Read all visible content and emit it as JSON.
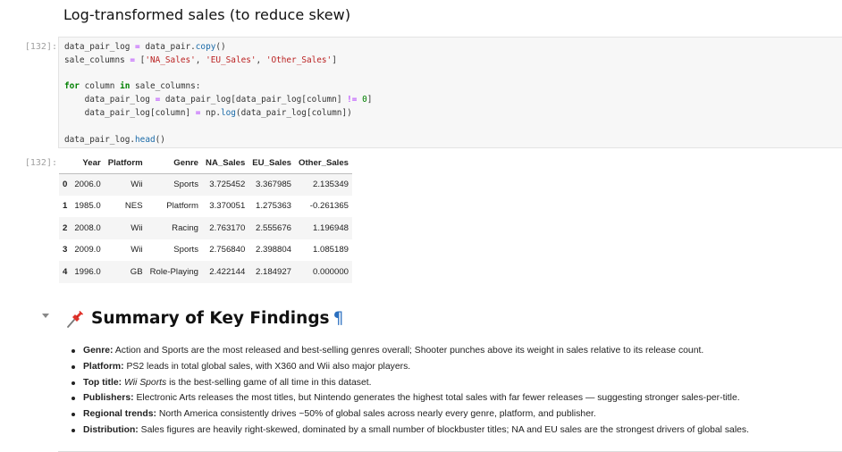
{
  "heading_cell": {
    "title": "Log-transformed sales (to reduce skew)"
  },
  "code_cell": {
    "in_prompt": "[132]:",
    "lines": {
      "l1a": "data_pair_log ",
      "l1b": "=",
      "l1c": " data_pair.",
      "l1d": "copy",
      "l1e": "()",
      "l2a": "sale_columns ",
      "l2b": "=",
      "l2c": " [",
      "l2d": "'NA_Sales'",
      "l2e": ", ",
      "l2f": "'EU_Sales'",
      "l2g": ", ",
      "l2h": "'Other_Sales'",
      "l2i": "]",
      "l4a": "for",
      "l4b": " column ",
      "l4c": "in",
      "l4d": " sale_columns:",
      "l5a": "    data_pair_log ",
      "l5b": "=",
      "l5c": " data_pair_log[data_pair_log[column] ",
      "l5d": "!=",
      "l5e": " ",
      "l5f": "0",
      "l5g": "]",
      "l6a": "    data_pair_log[column] ",
      "l6b": "=",
      "l6c": " np.",
      "l6d": "log",
      "l6e": "(data_pair_log[column])",
      "l8a": "data_pair_log.",
      "l8b": "head",
      "l8c": "()"
    }
  },
  "output": {
    "out_prompt": "[132]:",
    "table": {
      "index_header": "",
      "columns": [
        "Year",
        "Platform",
        "Genre",
        "NA_Sales",
        "EU_Sales",
        "Other_Sales"
      ],
      "rows": [
        {
          "index": "0",
          "cells": [
            "2006.0",
            "Wii",
            "Sports",
            "3.725452",
            "3.367985",
            "2.135349"
          ]
        },
        {
          "index": "1",
          "cells": [
            "1985.0",
            "NES",
            "Platform",
            "3.370051",
            "1.275363",
            "-0.261365"
          ]
        },
        {
          "index": "2",
          "cells": [
            "2008.0",
            "Wii",
            "Racing",
            "2.763170",
            "2.555676",
            "1.196948"
          ]
        },
        {
          "index": "3",
          "cells": [
            "2009.0",
            "Wii",
            "Sports",
            "2.756840",
            "2.398804",
            "1.085189"
          ]
        },
        {
          "index": "4",
          "cells": [
            "1996.0",
            "GB",
            "Role-Playing",
            "2.422144",
            "2.184927",
            "0.000000"
          ]
        }
      ]
    }
  },
  "summary": {
    "icon": "pushpin-icon",
    "title": "Summary of Key Findings",
    "anchor": "¶",
    "items": [
      {
        "label": "Genre:",
        "text": " Action and Sports are the most released and best-selling genres overall; Shooter punches above its weight in sales relative to its release count."
      },
      {
        "label": "Platform:",
        "text": " PS2 leads in total global sales, with X360 and Wii also major players."
      },
      {
        "label": "Top title:",
        "em": "Wii Sports",
        "text": " is the best-selling game of all time in this dataset."
      },
      {
        "label": "Publishers:",
        "text": " Electronic Arts releases the most titles, but Nintendo generates the highest total sales with far fewer releases — suggesting stronger sales-per-title."
      },
      {
        "label": "Regional trends:",
        "text": " North America consistently drives ~50% of global sales across nearly every genre, platform, and publisher."
      },
      {
        "label": "Distribution:",
        "text": " Sales figures are heavily right-skewed, dominated by a small number of blockbuster titles; NA and EU sales are the strongest drivers of global sales."
      }
    ]
  },
  "colors": {
    "pilcrow": "#2a6fbf",
    "pin": "#e0322b",
    "code_bg": "#f7f7f7"
  }
}
